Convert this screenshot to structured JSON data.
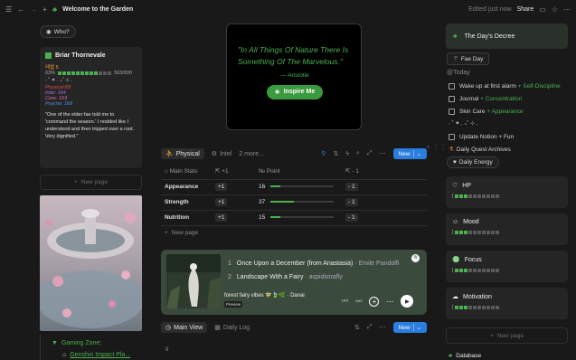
{
  "topbar": {
    "title": "Welcome to the Garden",
    "edited": "Edited just now",
    "share": "Share"
  },
  "left": {
    "who_label": "Who?",
    "profile": {
      "name": "Briar Thornevale",
      "level": "레벨 5",
      "xp_pct": "63%",
      "xp": "563/600",
      "divider": "· ˚ ✦ . ₊˚ ⊹ .",
      "stats": {
        "physical": "Physical:68",
        "intel": "Intel: 164",
        "core": "Core: 163",
        "psyche": "Psyche: 168"
      },
      "quote": "\"One of the elder fae told me to 'command the season.' I nodded like I understood and then tripped over a root. Very dignified.\""
    },
    "new_page": "New page",
    "gaming_zone": "Gaming Zone:",
    "gaming_item": "Genshin Impact Pla..."
  },
  "quote_card": {
    "text": "\"In All Things Of Nature There Is Something Of The Marvelous.\"",
    "author": "— Aristotle",
    "button": "Inspire Me"
  },
  "stats_view": {
    "tabs": [
      "Physical",
      "Intel",
      "2 more..."
    ],
    "new_label": "New",
    "headers": [
      "Main Stats",
      "+1",
      "Point",
      "- 1"
    ],
    "rows": [
      {
        "name": "Appearance",
        "plus": "+1",
        "point": "16",
        "minus": "- 1",
        "fill": 0.16
      },
      {
        "name": "Strength",
        "plus": "+1",
        "point": "37",
        "minus": "- 1",
        "fill": 0.37
      },
      {
        "name": "Nutrition",
        "plus": "+1",
        "point": "15",
        "minus": "- 1",
        "fill": 0.15
      }
    ],
    "new_page": "New page"
  },
  "music": {
    "tracks": [
      {
        "num": "1",
        "title": "Once Upon a December (from Anastasia)",
        "artist": "· Emile Pandolfi"
      },
      {
        "num": "2",
        "title": "Landscape With a Fairy",
        "artist": "· aspidistrafly"
      }
    ],
    "playlist": "forest fairy vibes 🧚🍃🌿 · Danai",
    "preview": "Preview"
  },
  "bottom_tabs": {
    "main_view": "Main View",
    "daily_log": "Daily Log",
    "new_label": "New",
    "cell": "8"
  },
  "right": {
    "decree": "The Day's Decree",
    "fae_day": "Fae Day",
    "today": "@Today",
    "tasks": [
      {
        "label": "Wake up at first alarm",
        "tag": "+ Self-Discipline"
      },
      {
        "label": "Journal",
        "tag": "+ Concentration"
      },
      {
        "label": "Skin Care",
        "tag": "+ Appearance"
      }
    ],
    "divider": "· ˚ ✦ . ₊˚ ⊹ .",
    "task4": {
      "label": "Update Notion + Fun",
      "tag": ""
    },
    "quest_archives": "Daily Quest Archives",
    "daily_energy": "Daily Energy",
    "energy": [
      {
        "label": "HP",
        "level": 0.3
      },
      {
        "label": "Mood",
        "level": 0.3
      },
      {
        "label": "Focus",
        "level": 0.3
      },
      {
        "label": "Motivation",
        "level": 0.3
      }
    ],
    "new_page": "New page",
    "database": "Database"
  },
  "colors": {
    "accent_green": "#4caf50",
    "blue": "#2a7ee0"
  }
}
